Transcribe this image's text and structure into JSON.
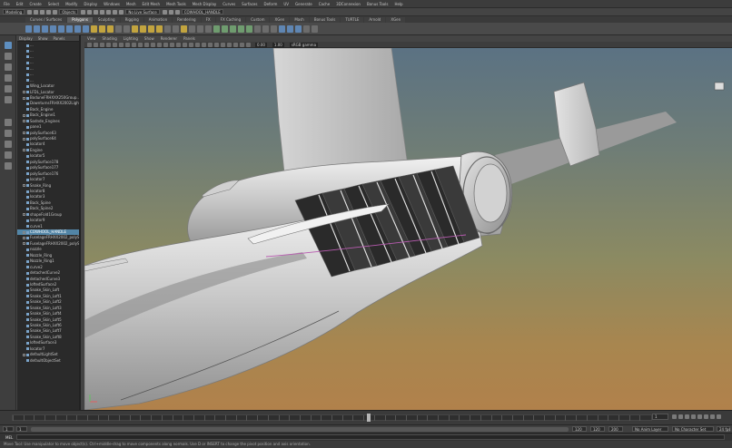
{
  "menu": {
    "items": [
      "File",
      "Edit",
      "Create",
      "Select",
      "Modify",
      "Display",
      "Windows",
      "Mesh",
      "Edit Mesh",
      "Mesh Tools",
      "Mesh Display",
      "Curves",
      "Surfaces",
      "Deform",
      "UV",
      "Generate",
      "Cache",
      "3DConnexion",
      "Bonus Tools",
      "Help"
    ]
  },
  "statusline": {
    "mode": "Modeling",
    "objects_label": "Objects",
    "live_surface": "No Live Surface",
    "field": "COWHOOL_HANDLE"
  },
  "shelf": {
    "tabs": [
      "Curves / Surfaces",
      "Polygons",
      "Sculpting",
      "Rigging",
      "Animation",
      "Rendering",
      "FX",
      "FX Caching",
      "Custom",
      "XGen",
      "Mash",
      "Bonus Tools",
      "TURTLE",
      "Arnold",
      "XGen"
    ],
    "active_tab": "Polygons"
  },
  "outliner": {
    "menu": [
      "Display",
      "Show",
      "Panels"
    ],
    "items": [
      {
        "label": "...",
        "expander": false
      },
      {
        "label": "...",
        "expander": false
      },
      {
        "label": "...",
        "expander": false
      },
      {
        "label": "...",
        "expander": false
      },
      {
        "label": "...",
        "expander": false
      },
      {
        "label": "...",
        "expander": false
      },
      {
        "label": "...",
        "expander": false
      },
      {
        "label": "Wing_Locator",
        "expander": false
      },
      {
        "label": "LFDL_Locator",
        "expander": true
      },
      {
        "label": "BoduneFRHXXX250Group...",
        "expander": true
      },
      {
        "label": "DownturnsFRHXX2002Light",
        "expander": false
      },
      {
        "label": "Back_Engine",
        "expander": false
      },
      {
        "label": "Back_Engine1",
        "expander": true
      },
      {
        "label": "Sodnde_Engines",
        "expander": true
      },
      {
        "label": "pane1",
        "expander": false
      },
      {
        "label": "polySurface63",
        "expander": true
      },
      {
        "label": "polySurface64",
        "expander": true
      },
      {
        "label": "locator4",
        "expander": false
      },
      {
        "label": "Engine",
        "expander": true
      },
      {
        "label": "locator5",
        "expander": false
      },
      {
        "label": "polySurface178",
        "expander": false
      },
      {
        "label": "polySurface177",
        "expander": false
      },
      {
        "label": "polySurface176",
        "expander": false
      },
      {
        "label": "locator7",
        "expander": false
      },
      {
        "label": "Snake_Ring",
        "expander": true
      },
      {
        "label": "locator8",
        "expander": false
      },
      {
        "label": "locator3",
        "expander": false
      },
      {
        "label": "Back_Spine",
        "expander": false
      },
      {
        "label": "Back_Spine2",
        "expander": false
      },
      {
        "label": "shapeFold1Group",
        "expander": true
      },
      {
        "label": "locator9",
        "expander": false
      },
      {
        "label": "curve1",
        "expander": false
      },
      {
        "label": "COWHOOL_HANDLE",
        "expander": true,
        "selected": true
      },
      {
        "label": "FuselageFRHXX2002_polySurf...",
        "expander": true
      },
      {
        "label": "FuselageFRHXX2002_polySurf...",
        "expander": true
      },
      {
        "label": "nozzle",
        "expander": false
      },
      {
        "label": "Nozzle_Ring",
        "expander": false
      },
      {
        "label": "Nozzle_Ring1",
        "expander": false
      },
      {
        "label": "curve2",
        "expander": false
      },
      {
        "label": "detachedCurve2",
        "expander": false
      },
      {
        "label": "detachedCurve3",
        "expander": false
      },
      {
        "label": "loftedSurface2",
        "expander": false
      },
      {
        "label": "Snake_Skin_Loft",
        "expander": false
      },
      {
        "label": "Snake_Skin_Loft1",
        "expander": false
      },
      {
        "label": "Snake_Skin_Loft2",
        "expander": false
      },
      {
        "label": "Snake_Skin_Loft3",
        "expander": false
      },
      {
        "label": "Snake_Skin_Loft4",
        "expander": false
      },
      {
        "label": "Snake_Skin_Loft5",
        "expander": false
      },
      {
        "label": "Snake_Skin_Loft6",
        "expander": false
      },
      {
        "label": "Snake_Skin_Loft7",
        "expander": false
      },
      {
        "label": "Snake_Skin_Loft8",
        "expander": false
      },
      {
        "label": "loftedSurface3",
        "expander": false
      },
      {
        "label": "locator7",
        "expander": false
      },
      {
        "label": "defaultLightSet",
        "expander": true
      },
      {
        "label": "defaultObjectSet",
        "expander": false
      }
    ]
  },
  "viewport": {
    "menu": [
      "View",
      "Shading",
      "Lighting",
      "Show",
      "Renderer",
      "Panels"
    ],
    "near": "0.00",
    "far": "1.00",
    "colorspace": "sRGB gamma",
    "camera_label": ""
  },
  "timeline": {
    "current_frame": "1",
    "field_right": "1"
  },
  "range": {
    "start": "1",
    "start_inner": "1",
    "end_inner": "120",
    "end": "120",
    "end2": "200",
    "anim_layer": "No Anim Layer",
    "char_set": "No Character Set",
    "fps": "24 fps"
  },
  "command": {
    "label": "MEL"
  },
  "help": {
    "text": "Move Tool: Use manipulator to move object(s). Ctrl+middle-drag to move components along normals. Use D or INSERT to change the pivot position and axis orientation."
  },
  "colors": {
    "selection": "#5285a6",
    "shelf_active": "#5d5d5d",
    "viewport_top": "#5b7283",
    "viewport_bottom": "#b1814b"
  }
}
